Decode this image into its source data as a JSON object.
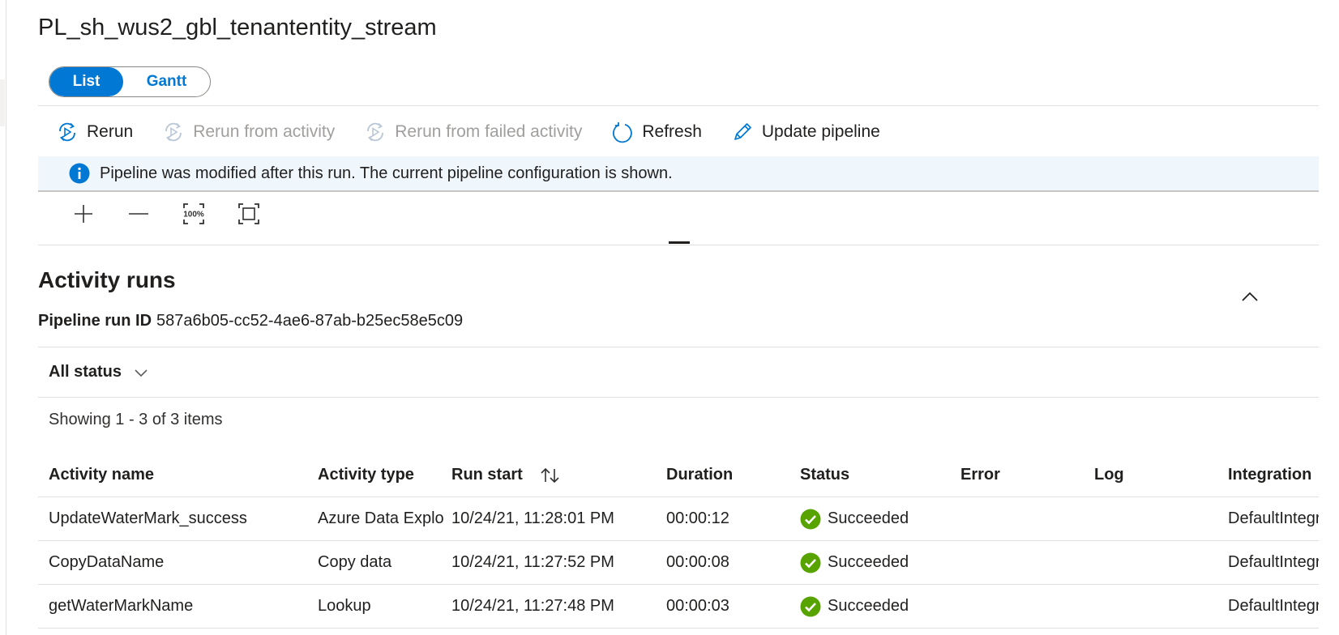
{
  "pipeline": {
    "title": "PL_sh_wus2_gbl_tenantentity_stream"
  },
  "view_toggle": {
    "list_label": "List",
    "gantt_label": "Gantt"
  },
  "toolbar": {
    "rerun": "Rerun",
    "rerun_from_activity": "Rerun from activity",
    "rerun_from_failed": "Rerun from failed activity",
    "refresh": "Refresh",
    "update_pipeline": "Update pipeline"
  },
  "info_bar": {
    "message": "Pipeline was modified after this run. The current pipeline configuration is shown."
  },
  "activity_runs": {
    "title": "Activity runs",
    "run_id_label": "Pipeline run ID",
    "run_id": "587a6b05-cc52-4ae6-87ab-b25ec58e5c09",
    "filter_label": "All status",
    "showing": "Showing 1 - 3 of 3 items",
    "columns": [
      "Activity name",
      "Activity type",
      "Run start",
      "Duration",
      "Status",
      "Error",
      "Log",
      "Integration"
    ],
    "rows": [
      {
        "name": "UpdateWaterMark_success",
        "type": "Azure Data Explorer",
        "start": "10/24/21, 11:28:01 PM",
        "duration": "00:00:12",
        "status": "Succeeded",
        "error": "",
        "log": "",
        "integration": "DefaultIntegrationRuntime"
      },
      {
        "name": "CopyDataName",
        "type": "Copy data",
        "start": "10/24/21, 11:27:52 PM",
        "duration": "00:00:08",
        "status": "Succeeded",
        "error": "",
        "log": "",
        "integration": "DefaultIntegrationRuntime"
      },
      {
        "name": "getWaterMarkName",
        "type": "Lookup",
        "start": "10/24/21, 11:27:48 PM",
        "duration": "00:00:03",
        "status": "Succeeded",
        "error": "",
        "log": "",
        "integration": "DefaultIntegrationRuntime"
      }
    ]
  },
  "colors": {
    "accent": "#0078d4",
    "success": "#57a300",
    "info_bg": "#eff6fc",
    "disabled": "#a19f9d"
  }
}
